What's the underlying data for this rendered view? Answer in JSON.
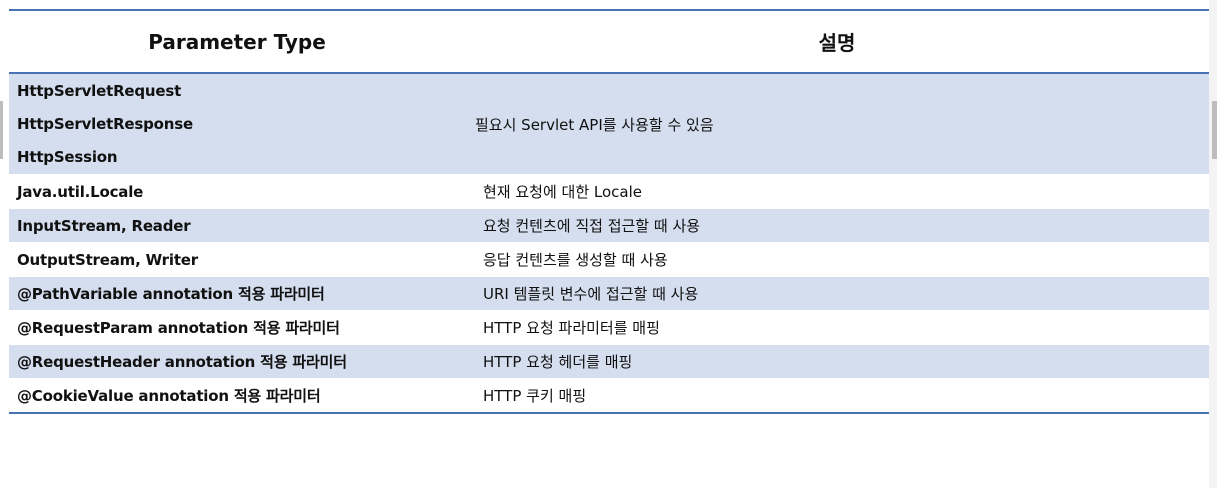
{
  "table": {
    "headers": {
      "param_type": "Parameter Type",
      "description": "설명"
    },
    "rows": [
      {
        "types": [
          "HttpServletRequest",
          "HttpServletResponse",
          "HttpSession"
        ],
        "description": "필요시 Servlet API를 사용할 수 있음",
        "shade": "blue"
      },
      {
        "types": [
          "Java.util.Locale"
        ],
        "description": "현재 요청에 대한 Locale",
        "shade": "white"
      },
      {
        "types": [
          "InputStream, Reader"
        ],
        "description": "요청 컨텐츠에 직접 접근할 때 사용",
        "shade": "blue"
      },
      {
        "types": [
          "OutputStream, Writer"
        ],
        "description": "응답 컨텐츠를 생성할 때 사용",
        "shade": "white"
      },
      {
        "types": [
          "@PathVariable annotation 적용 파라미터"
        ],
        "description": "URI 템플릿 변수에 접근할 때 사용",
        "shade": "blue"
      },
      {
        "types": [
          "@RequestParam annotation 적용 파라미터"
        ],
        "description": "HTTP 요청 파라미터를 매핑",
        "shade": "white"
      },
      {
        "types": [
          "@RequestHeader annotation 적용 파라미터"
        ],
        "description": "HTTP 요청 헤더를 매핑",
        "shade": "blue"
      },
      {
        "types": [
          "@CookieValue annotation 적용 파라미터"
        ],
        "description": "HTTP 쿠키 매핑",
        "shade": "white"
      }
    ]
  },
  "colors": {
    "rule": "#4a73b5",
    "row_shade": "#d5deee"
  }
}
